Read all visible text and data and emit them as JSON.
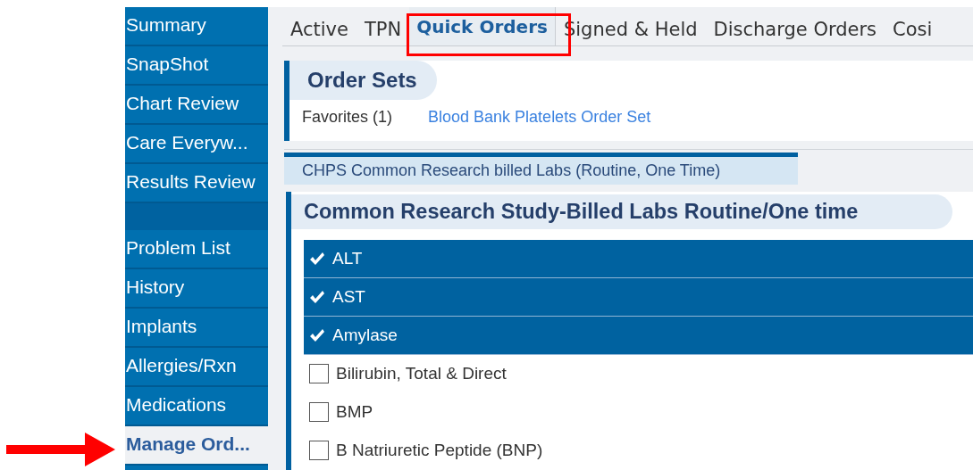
{
  "sidebar": {
    "items": [
      {
        "kind": "item",
        "label": "Summary",
        "selected": false
      },
      {
        "kind": "item",
        "label": "SnapShot",
        "selected": false
      },
      {
        "kind": "item",
        "label": "Chart Review",
        "selected": false
      },
      {
        "kind": "item",
        "label": "Care Everyw...",
        "selected": false
      },
      {
        "kind": "item",
        "label": "Results Review",
        "selected": false
      },
      {
        "kind": "gap"
      },
      {
        "kind": "item",
        "label": "Problem List",
        "selected": false
      },
      {
        "kind": "item",
        "label": "History",
        "selected": false
      },
      {
        "kind": "item",
        "label": "Implants",
        "selected": false
      },
      {
        "kind": "item",
        "label": "Allergies/Rxn",
        "selected": false
      },
      {
        "kind": "item",
        "label": "Medications",
        "selected": false
      },
      {
        "kind": "item",
        "label": "Manage Ord...",
        "selected": true
      }
    ]
  },
  "tabs": [
    {
      "label": "Active",
      "selected": false
    },
    {
      "label": "TPN",
      "selected": false
    },
    {
      "label": "Quick Orders",
      "selected": true
    },
    {
      "label": "Signed & Held",
      "selected": false
    },
    {
      "label": "Discharge Orders",
      "selected": false
    },
    {
      "label": "Cosi",
      "selected": false
    }
  ],
  "order_sets": {
    "title": "Order Sets",
    "favorites": "Favorites (1)",
    "link": "Blood Bank Platelets Order Set"
  },
  "section_tab": {
    "label": "CHPS Common Research billed Labs (Routine, One Time)"
  },
  "order_group": {
    "title": "Common Research Study-Billed Labs Routine/One time",
    "items": [
      {
        "label": "ALT",
        "checked": true
      },
      {
        "label": "AST",
        "checked": true
      },
      {
        "label": "Amylase",
        "checked": true
      },
      {
        "label": "Bilirubin, Total & Direct",
        "checked": false
      },
      {
        "label": "BMP",
        "checked": false
      },
      {
        "label": "B Natriuretic Peptide (BNP)",
        "checked": false
      }
    ]
  }
}
